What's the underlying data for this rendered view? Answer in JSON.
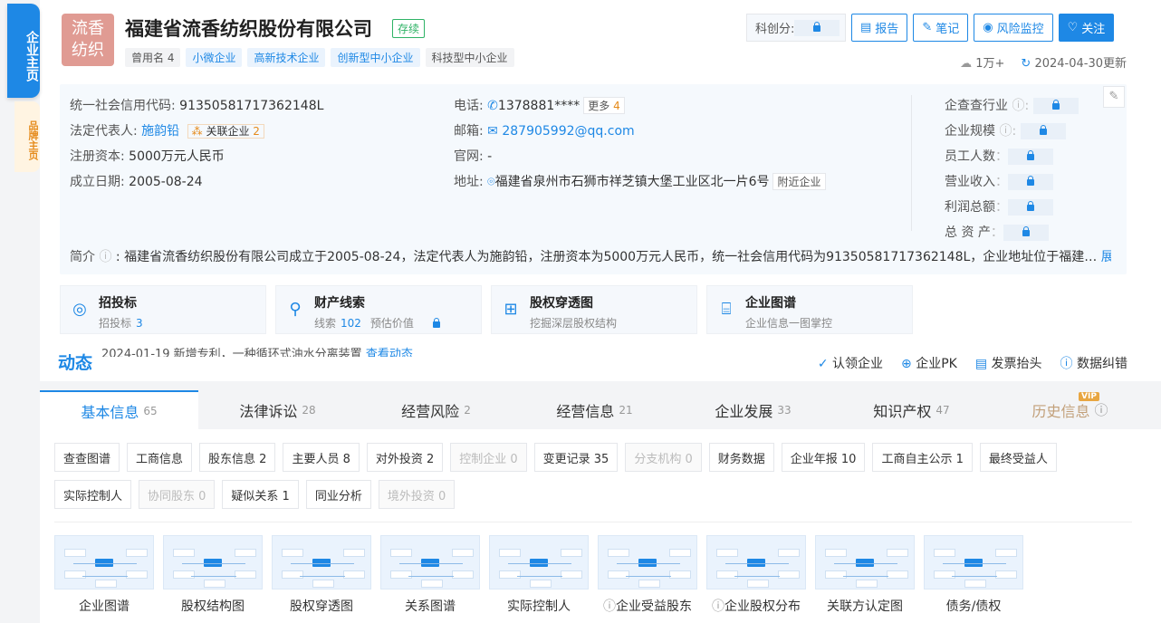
{
  "side": {
    "main": "企业主页",
    "brand": "品牌主页"
  },
  "company": {
    "logo_text": "流香纺织",
    "name": "福建省流香纺织股份有限公司",
    "status": "存续",
    "tags": [
      {
        "t": "曾用名 4",
        "c": "g"
      },
      {
        "t": "小微企业",
        "c": "b"
      },
      {
        "t": "高新技术企业",
        "c": "b"
      },
      {
        "t": "创新型中小企业",
        "c": "b"
      },
      {
        "t": "科技型中小企业",
        "c": "g"
      }
    ]
  },
  "actions": {
    "kechuang": "科创分:",
    "report": "报告",
    "note": "笔记",
    "monitor": "风险监控",
    "follow": "关注"
  },
  "meta": {
    "views": "1万+",
    "updated": "2024-04-30更新"
  },
  "info": {
    "credit_label": "统一社会信用代码:",
    "credit": "91350581717362148L",
    "legal_label": "法定代表人:",
    "legal": "施韵铅",
    "related": "关联企业",
    "related_n": "2",
    "capital_label": "注册资本:",
    "capital": "5000万元人民币",
    "date_label": "成立日期:",
    "date": "2005-08-24",
    "phone_label": "电话:",
    "phone": "1378881****",
    "phone_more": "更多",
    "phone_more_n": "4",
    "email_label": "邮箱:",
    "email": "287905992@qq.com",
    "web_label": "官网:",
    "web": "-",
    "addr_label": "地址:",
    "addr": "福建省泉州市石狮市祥芝镇大堡工业区北一片6号",
    "nearby": "附近企业",
    "right": [
      "企查查行业",
      "企业规模",
      "员工人数",
      "营业收入",
      "利润总额",
      "总 资 产"
    ],
    "intro_label": "简介",
    "intro": "福建省流香纺织股份有限公司成立于2005-08-24，法定代表人为施韵铅，注册资本为5000万元人民币，统一社会信用代码为91350581717362148L，企业地址位于福建…",
    "expand": "展开"
  },
  "features": [
    {
      "icon": "◎",
      "t": "招投标",
      "s": "招投标",
      "n": "3"
    },
    {
      "icon": "⚲",
      "t": "财产线索",
      "s": "线索",
      "n": "102",
      "s2": "预估价值"
    },
    {
      "icon": "⊞",
      "t": "股权穿透图",
      "s": "挖掘深层股权结构"
    },
    {
      "icon": "⌸",
      "t": "企业图谱",
      "s": "企业信息一图掌控"
    }
  ],
  "news": {
    "label": "动态",
    "text": "2024-01-19 新增专利，一种循环式油水分离装置",
    "link": "查看动态"
  },
  "bottom_actions": [
    "认领企业",
    "企业PK",
    "发票抬头",
    "数据纠错"
  ],
  "tabs": [
    {
      "l": "基本信息",
      "n": "65"
    },
    {
      "l": "法律诉讼",
      "n": "28"
    },
    {
      "l": "经营风险",
      "n": "2"
    },
    {
      "l": "经营信息",
      "n": "21"
    },
    {
      "l": "企业发展",
      "n": "33"
    },
    {
      "l": "知识产权",
      "n": "47"
    },
    {
      "l": "历史信息",
      "n": "",
      "vip": "VIP"
    }
  ],
  "chips": [
    {
      "t": "查查图谱",
      "d": false
    },
    {
      "t": "工商信息",
      "d": false
    },
    {
      "t": "股东信息 2",
      "d": false
    },
    {
      "t": "主要人员 8",
      "d": false
    },
    {
      "t": "对外投资 2",
      "d": false
    },
    {
      "t": "控制企业 0",
      "d": true
    },
    {
      "t": "变更记录 35",
      "d": false
    },
    {
      "t": "分支机构 0",
      "d": true
    },
    {
      "t": "财务数据",
      "d": false
    },
    {
      "t": "企业年报 10",
      "d": false
    },
    {
      "t": "工商自主公示 1",
      "d": false
    },
    {
      "t": "最终受益人",
      "d": false
    },
    {
      "t": "实际控制人",
      "d": false
    },
    {
      "t": "协同股东 0",
      "d": true
    },
    {
      "t": "疑似关系 1",
      "d": false
    },
    {
      "t": "同业分析",
      "d": false
    },
    {
      "t": "境外投资 0",
      "d": true
    }
  ],
  "graphs": [
    "企业图谱",
    "股权结构图",
    "股权穿透图",
    "关系图谱",
    "实际控制人",
    "企业受益股东",
    "企业股权分布",
    "关联方认定图",
    "债务/债权"
  ]
}
